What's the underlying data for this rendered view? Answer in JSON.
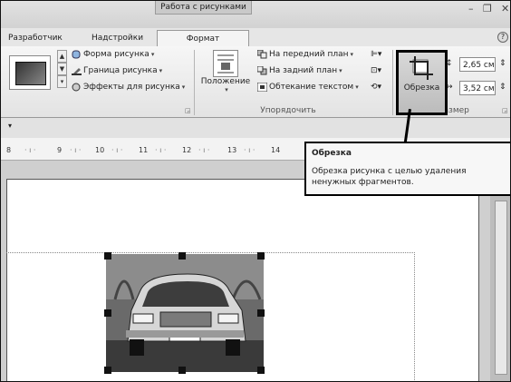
{
  "window": {
    "context_tab": "Работа с рисунками",
    "minimize": "–",
    "restore": "❐",
    "close": "✕",
    "help": "?"
  },
  "tabs": [
    {
      "label": "Разработчик"
    },
    {
      "label": "Надстройки"
    },
    {
      "label": "Формат"
    }
  ],
  "ribbon": {
    "picture_styles": {
      "shape": "Форма рисунка",
      "border": "Граница рисунка",
      "effects": "Эффекты для рисунка"
    },
    "arrange": {
      "position": "Положение",
      "bring_forward": "На передний план",
      "send_backward": "На задний план",
      "text_wrapping": "Обтекание текстом",
      "group_label": "Упорядочить"
    },
    "size": {
      "crop": "Обрезка",
      "height": "2,65 см",
      "width": "3,52 см",
      "group_label": "Размер"
    }
  },
  "ruler": {
    "ticks": [
      "8",
      "9",
      "10",
      "11",
      "12",
      "13",
      "14"
    ]
  },
  "tooltip": {
    "title": "Обрезка",
    "body": "Обрезка рисунка с целью удаления ненужных фрагментов."
  }
}
